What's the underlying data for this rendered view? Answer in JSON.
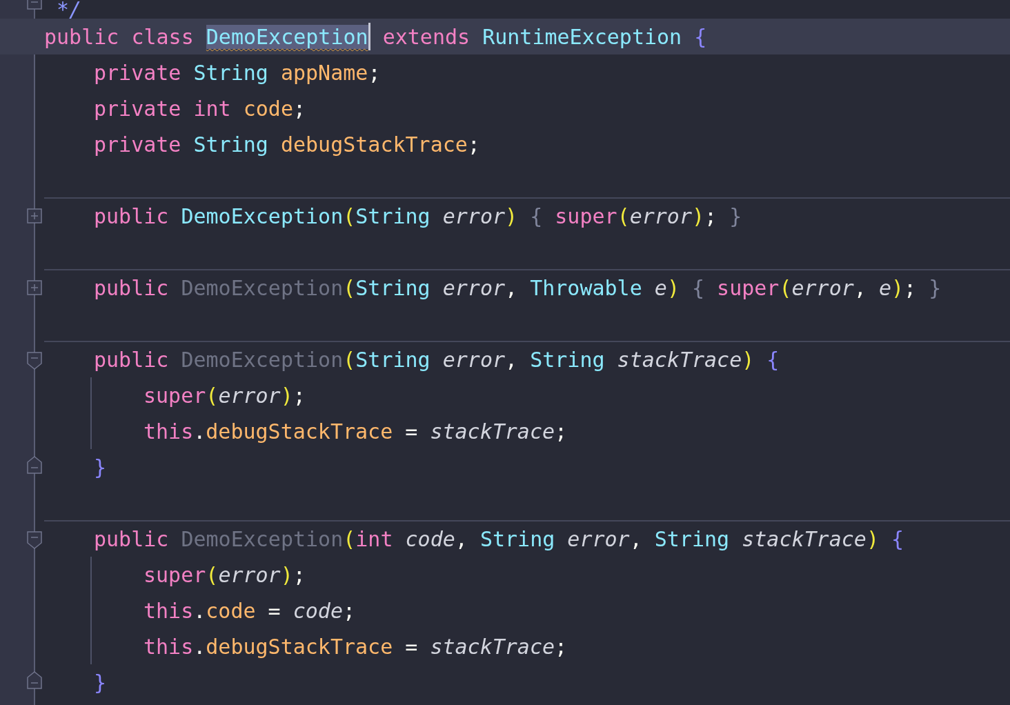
{
  "editor": {
    "lines": [
      {
        "kind": "code",
        "fold": {
          "kind": "collapse_box"
        },
        "tokens": [
          {
            "kind": "comment",
            "text": " */"
          }
        ]
      },
      {
        "kind": "code",
        "current": true,
        "tokens": [
          {
            "kind": "keyword",
            "text": "public"
          },
          {
            "kind": "keyword",
            "text": " class "
          },
          {
            "kind": "type",
            "text": "DemoException",
            "highlighted": true,
            "warning": true,
            "caret": true
          },
          {
            "kind": "keyword",
            "text": " extends"
          },
          {
            "kind": "type",
            "text": " RuntimeException"
          },
          {
            "kind": "brace",
            "text": " {"
          }
        ],
        "children": [
          {
            "kind": "code",
            "tokens": [
              {
                "kind": "keyword",
                "text": "private"
              },
              {
                "kind": "type",
                "text": " String"
              },
              {
                "kind": "field",
                "text": " appName"
              },
              {
                "kind": "punct",
                "text": ";"
              }
            ]
          },
          {
            "kind": "code",
            "tokens": [
              {
                "kind": "keyword",
                "text": "private"
              },
              {
                "kind": "keyword",
                "text": " int"
              },
              {
                "kind": "field",
                "text": " code"
              },
              {
                "kind": "punct",
                "text": ";"
              }
            ]
          },
          {
            "kind": "code",
            "tokens": [
              {
                "kind": "keyword",
                "text": "private"
              },
              {
                "kind": "type",
                "text": " String"
              },
              {
                "kind": "field",
                "text": " debugStackTrace"
              },
              {
                "kind": "punct",
                "text": ";"
              }
            ]
          },
          {
            "kind": "blank"
          },
          {
            "kind": "code",
            "separator": true,
            "fold": {
              "kind": "expand"
            },
            "tokens": [
              {
                "kind": "keyword",
                "text": "public"
              },
              {
                "kind": "type",
                "text": " DemoException"
              },
              {
                "kind": "paren",
                "text": "("
              },
              {
                "kind": "type",
                "text": "String"
              },
              {
                "kind": "param",
                "text": " error"
              },
              {
                "kind": "paren",
                "text": ")"
              },
              {
                "kind": "folded",
                "text": " {"
              },
              {
                "kind": "keyword",
                "text": " super"
              },
              {
                "kind": "paren",
                "text": "("
              },
              {
                "kind": "param",
                "text": "error"
              },
              {
                "kind": "paren",
                "text": ")"
              },
              {
                "kind": "punct",
                "text": ";"
              },
              {
                "kind": "folded",
                "text": " }"
              }
            ]
          },
          {
            "kind": "blank"
          },
          {
            "kind": "code",
            "separator": true,
            "fold": {
              "kind": "expand"
            },
            "tokens": [
              {
                "kind": "keyword",
                "text": "public"
              },
              {
                "kind": "unused",
                "text": " DemoException"
              },
              {
                "kind": "paren",
                "text": "("
              },
              {
                "kind": "type",
                "text": "String"
              },
              {
                "kind": "param",
                "text": " error"
              },
              {
                "kind": "punct",
                "text": ","
              },
              {
                "kind": "type",
                "text": " Throwable"
              },
              {
                "kind": "param",
                "text": " e"
              },
              {
                "kind": "paren",
                "text": ")"
              },
              {
                "kind": "folded",
                "text": " {"
              },
              {
                "kind": "keyword",
                "text": " super"
              },
              {
                "kind": "paren",
                "text": "("
              },
              {
                "kind": "param",
                "text": "error"
              },
              {
                "kind": "punct",
                "text": ","
              },
              {
                "kind": "param",
                "text": " e"
              },
              {
                "kind": "paren",
                "text": ")"
              },
              {
                "kind": "punct",
                "text": ";"
              },
              {
                "kind": "folded",
                "text": " }"
              }
            ]
          },
          {
            "kind": "blank"
          },
          {
            "kind": "code",
            "separator": true,
            "fold": {
              "kind": "block_start"
            },
            "tokens": [
              {
                "kind": "keyword",
                "text": "public"
              },
              {
                "kind": "unused",
                "text": " DemoException"
              },
              {
                "kind": "paren",
                "text": "("
              },
              {
                "kind": "type",
                "text": "String"
              },
              {
                "kind": "param",
                "text": " error"
              },
              {
                "kind": "punct",
                "text": ","
              },
              {
                "kind": "type",
                "text": " String"
              },
              {
                "kind": "param",
                "text": " stackTrace"
              },
              {
                "kind": "paren",
                "text": ")"
              },
              {
                "kind": "brace",
                "text": " {"
              }
            ],
            "children": [
              {
                "kind": "code",
                "guide": true,
                "tokens": [
                  {
                    "kind": "keyword",
                    "text": "super"
                  },
                  {
                    "kind": "paren",
                    "text": "("
                  },
                  {
                    "kind": "param",
                    "text": "error"
                  },
                  {
                    "kind": "paren",
                    "text": ")"
                  },
                  {
                    "kind": "punct",
                    "text": ";"
                  }
                ]
              },
              {
                "kind": "code",
                "guide": true,
                "tokens": [
                  {
                    "kind": "keyword",
                    "text": "this"
                  },
                  {
                    "kind": "punct",
                    "text": "."
                  },
                  {
                    "kind": "field",
                    "text": "debugStackTrace"
                  },
                  {
                    "kind": "punct",
                    "text": " ="
                  },
                  {
                    "kind": "param",
                    "text": " stackTrace"
                  },
                  {
                    "kind": "punct",
                    "text": ";"
                  }
                ]
              }
            ]
          },
          {
            "kind": "code",
            "fold": {
              "kind": "block_end"
            },
            "tokens": [
              {
                "kind": "brace",
                "text": "}"
              }
            ]
          },
          {
            "kind": "blank"
          },
          {
            "kind": "code",
            "separator": true,
            "fold": {
              "kind": "block_start"
            },
            "tokens": [
              {
                "kind": "keyword",
                "text": "public"
              },
              {
                "kind": "unused",
                "text": " DemoException"
              },
              {
                "kind": "paren",
                "text": "("
              },
              {
                "kind": "keyword",
                "text": "int"
              },
              {
                "kind": "param",
                "text": " code"
              },
              {
                "kind": "punct",
                "text": ","
              },
              {
                "kind": "type",
                "text": " String"
              },
              {
                "kind": "param",
                "text": " error"
              },
              {
                "kind": "punct",
                "text": ","
              },
              {
                "kind": "type",
                "text": " String"
              },
              {
                "kind": "param",
                "text": " stackTrace"
              },
              {
                "kind": "paren",
                "text": ")"
              },
              {
                "kind": "brace",
                "text": " {"
              }
            ],
            "children": [
              {
                "kind": "code",
                "guide": true,
                "tokens": [
                  {
                    "kind": "keyword",
                    "text": "super"
                  },
                  {
                    "kind": "paren",
                    "text": "("
                  },
                  {
                    "kind": "param",
                    "text": "error"
                  },
                  {
                    "kind": "paren",
                    "text": ")"
                  },
                  {
                    "kind": "punct",
                    "text": ";"
                  }
                ]
              },
              {
                "kind": "code",
                "guide": true,
                "tokens": [
                  {
                    "kind": "keyword",
                    "text": "this"
                  },
                  {
                    "kind": "punct",
                    "text": "."
                  },
                  {
                    "kind": "field",
                    "text": "code"
                  },
                  {
                    "kind": "punct",
                    "text": " ="
                  },
                  {
                    "kind": "param",
                    "text": " code"
                  },
                  {
                    "kind": "punct",
                    "text": ";"
                  }
                ]
              },
              {
                "kind": "code",
                "guide": true,
                "tokens": [
                  {
                    "kind": "keyword",
                    "text": "this"
                  },
                  {
                    "kind": "punct",
                    "text": "."
                  },
                  {
                    "kind": "field",
                    "text": "debugStackTrace"
                  },
                  {
                    "kind": "punct",
                    "text": " ="
                  },
                  {
                    "kind": "param",
                    "text": " stackTrace"
                  },
                  {
                    "kind": "punct",
                    "text": ";"
                  }
                ]
              }
            ]
          },
          {
            "kind": "code",
            "fold": {
              "kind": "block_end"
            },
            "tokens": [
              {
                "kind": "brace",
                "text": "}"
              }
            ]
          }
        ]
      }
    ]
  }
}
